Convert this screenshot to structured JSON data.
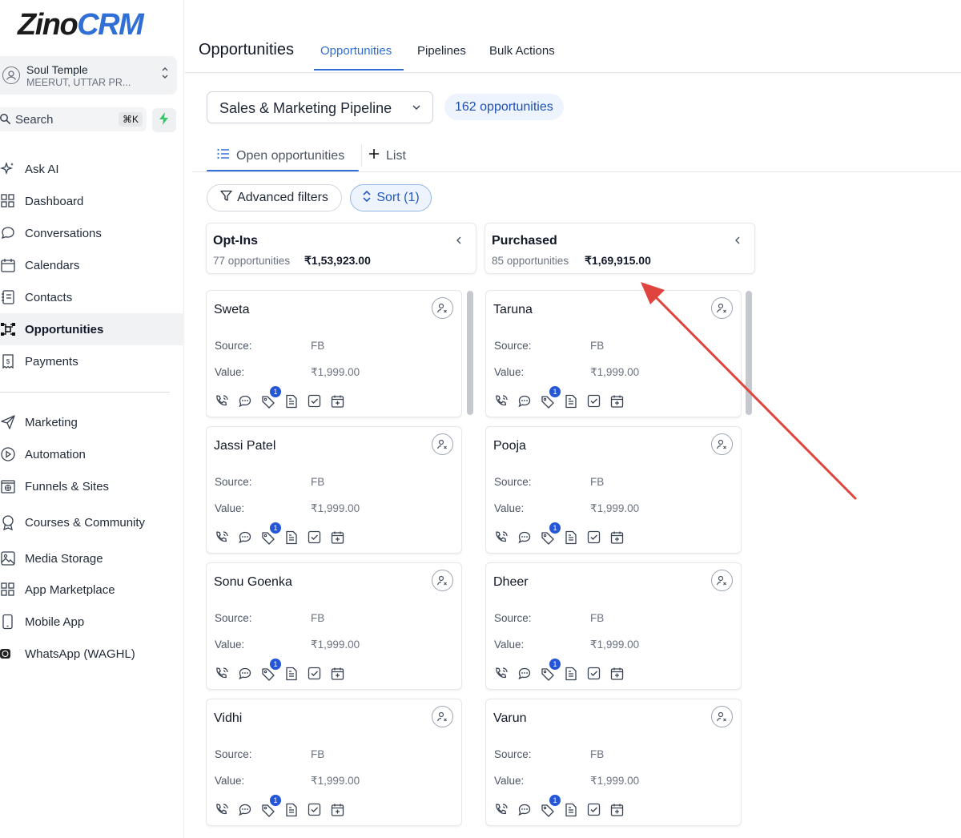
{
  "app": {
    "logo_part1": "Zino",
    "logo_part2": "CRM"
  },
  "account": {
    "name": "Soul Temple",
    "location": "MEERUT, UTTAR PR..."
  },
  "search": {
    "label": "Search",
    "shortcut": "⌘K"
  },
  "sidebar": {
    "items": [
      {
        "label": "Ask AI",
        "icon": "sparkle-icon"
      },
      {
        "label": "Dashboard",
        "icon": "grid-icon"
      },
      {
        "label": "Conversations",
        "icon": "chat-icon"
      },
      {
        "label": "Calendars",
        "icon": "calendar-icon"
      },
      {
        "label": "Contacts",
        "icon": "contacts-icon"
      },
      {
        "label": "Opportunities",
        "icon": "opportunities-icon",
        "active": true
      },
      {
        "label": "Payments",
        "icon": "payments-icon"
      },
      {
        "label": "Marketing",
        "icon": "send-icon"
      },
      {
        "label": "Automation",
        "icon": "automation-icon"
      },
      {
        "label": "Funnels & Sites",
        "icon": "globe-icon"
      },
      {
        "label": "Courses & Community",
        "icon": "award-icon"
      },
      {
        "label": "Media Storage",
        "icon": "image-icon"
      },
      {
        "label": "App Marketplace",
        "icon": "grid-icon"
      },
      {
        "label": "Mobile App",
        "icon": "phone-icon"
      },
      {
        "label": "WhatsApp (WAGHL)",
        "icon": "whatsapp-icon"
      }
    ]
  },
  "header": {
    "title": "Opportunities",
    "tabs": [
      {
        "label": "Opportunities",
        "active": true
      },
      {
        "label": "Pipelines"
      },
      {
        "label": "Bulk Actions"
      }
    ]
  },
  "toolbar": {
    "pipeline": "Sales & Marketing Pipeline",
    "count": "162 opportunities",
    "open_tab": "Open opportunities",
    "list_tab": "List",
    "filters": "Advanced filters",
    "sort": "Sort (1)"
  },
  "card_labels": {
    "source": "Source:",
    "value": "Value:"
  },
  "columns": [
    {
      "title": "Opt-Ins",
      "count": "77 opportunities",
      "total": "₹1,53,923.00",
      "cards": [
        {
          "name": "Sweta",
          "source": "FB",
          "value": "₹1,999.00",
          "badge": "1"
        },
        {
          "name": "Jassi Patel",
          "source": "FB",
          "value": "₹1,999.00",
          "badge": "1"
        },
        {
          "name": "Sonu Goenka",
          "source": "FB",
          "value": "₹1,999.00",
          "badge": "1"
        },
        {
          "name": "Vidhi",
          "source": "FB",
          "value": "₹1,999.00",
          "badge": "1"
        }
      ]
    },
    {
      "title": "Purchased",
      "count": "85 opportunities",
      "total": "₹1,69,915.00",
      "cards": [
        {
          "name": "Taruna",
          "source": "FB",
          "value": "₹1,999.00",
          "badge": "1"
        },
        {
          "name": "Pooja",
          "source": "FB",
          "value": "₹1,999.00",
          "badge": "1"
        },
        {
          "name": "Dheer",
          "source": "FB",
          "value": "₹1,999.00",
          "badge": "1"
        },
        {
          "name": "Varun",
          "source": "FB",
          "value": "₹1,999.00",
          "badge": "1"
        }
      ]
    }
  ],
  "colors": {
    "accent": "#2f6fd6",
    "annotation_arrow": "#e0443e"
  }
}
